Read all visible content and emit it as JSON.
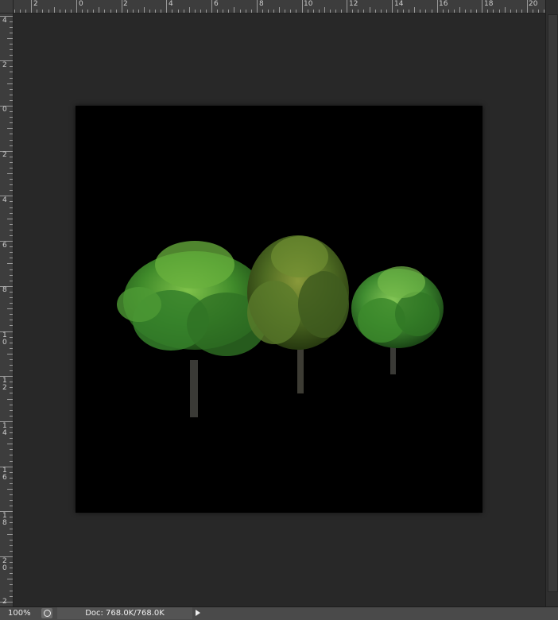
{
  "rulers": {
    "horizontal_labels": [
      "2",
      "0",
      "2",
      "4",
      "6",
      "8",
      "10",
      "12",
      "14",
      "16",
      "18",
      "20"
    ],
    "vertical_labels": [
      "4",
      "2",
      "0",
      "2",
      "4",
      "6",
      "8",
      "10",
      "12",
      "14",
      "16",
      "18",
      "20",
      "2"
    ]
  },
  "status_bar": {
    "zoom": "100%",
    "doc_info": "Doc: 768.0K/768.0K"
  },
  "icons": {
    "info": "info-circle-icon",
    "menu_arrow": "play-arrow-icon"
  },
  "colors": {
    "workspace": "#282828",
    "document": "#000000",
    "status_bar": "#4a4a4a"
  }
}
